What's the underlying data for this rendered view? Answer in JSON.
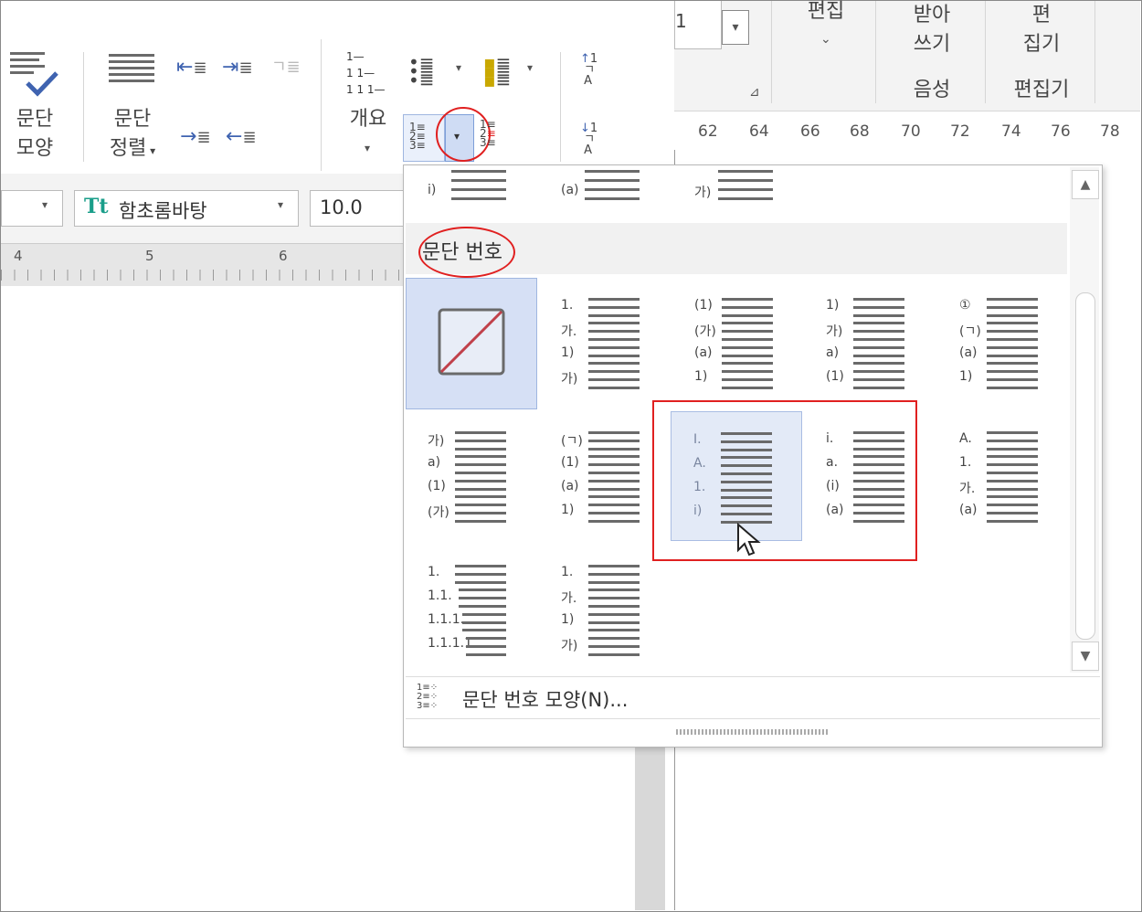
{
  "ribbon": {
    "para_shape": [
      "문단",
      "모양"
    ],
    "para_align": [
      "문단",
      "정렬"
    ],
    "outline_label": "개요",
    "outline_sample": [
      "1—",
      "1 1—",
      "1 1 1—"
    ],
    "font_name": "함초롬바탕",
    "font_size": "10.0",
    "right_groups": {
      "edit": "편집",
      "dictation": [
        "받아",
        "쓰기"
      ],
      "voice": "음성",
      "editor_top": [
        "편",
        "집기"
      ],
      "editor_bottom": "편집기"
    },
    "field_value": "1"
  },
  "ruler_top": [
    "62",
    "64",
    "66",
    "68",
    "70",
    "72",
    "74",
    "76",
    "78"
  ],
  "ruler_left": [
    "4",
    "5",
    "6"
  ],
  "dropdown": {
    "section_title": "문단 번호",
    "top_partial": [
      [
        "i)"
      ],
      [
        "(a)"
      ],
      [
        "가)"
      ]
    ],
    "rows": [
      [
        {
          "none": true
        },
        {
          "labels": [
            "1.",
            "가.",
            "1)",
            "가)"
          ]
        },
        {
          "labels": [
            "(1)",
            "(가)",
            "(a)",
            "1)"
          ]
        },
        {
          "labels": [
            "1)",
            "가)",
            "a)",
            "(1)"
          ]
        },
        {
          "labels": [
            "①",
            "(ㄱ)",
            "(a)",
            "1)"
          ]
        }
      ],
      [
        {
          "labels": [
            "가)",
            "a)",
            "(1)",
            "(가)"
          ]
        },
        {
          "labels": [
            "(ㄱ)",
            "(1)",
            "(a)",
            "1)"
          ]
        },
        {
          "labels": [
            "I.",
            "A.",
            "1.",
            "i)"
          ],
          "selected": true
        },
        {
          "labels": [
            "i.",
            "a.",
            "(i)",
            "(a)"
          ]
        },
        {
          "labels": [
            "A.",
            "1.",
            "가.",
            "(a)"
          ]
        }
      ],
      [
        {
          "labels": [
            "1.",
            "1.1.",
            "1.1.1.",
            "1.1.1.1."
          ]
        },
        {
          "labels": [
            "1.",
            "가.",
            "1)",
            "가)"
          ]
        }
      ]
    ],
    "footer_label": "문단 번호 모양(N)..."
  },
  "colors": {
    "accent": "#3f63b0",
    "highlight_red": "#e02020",
    "selected_bg": "#d6e0f5"
  }
}
